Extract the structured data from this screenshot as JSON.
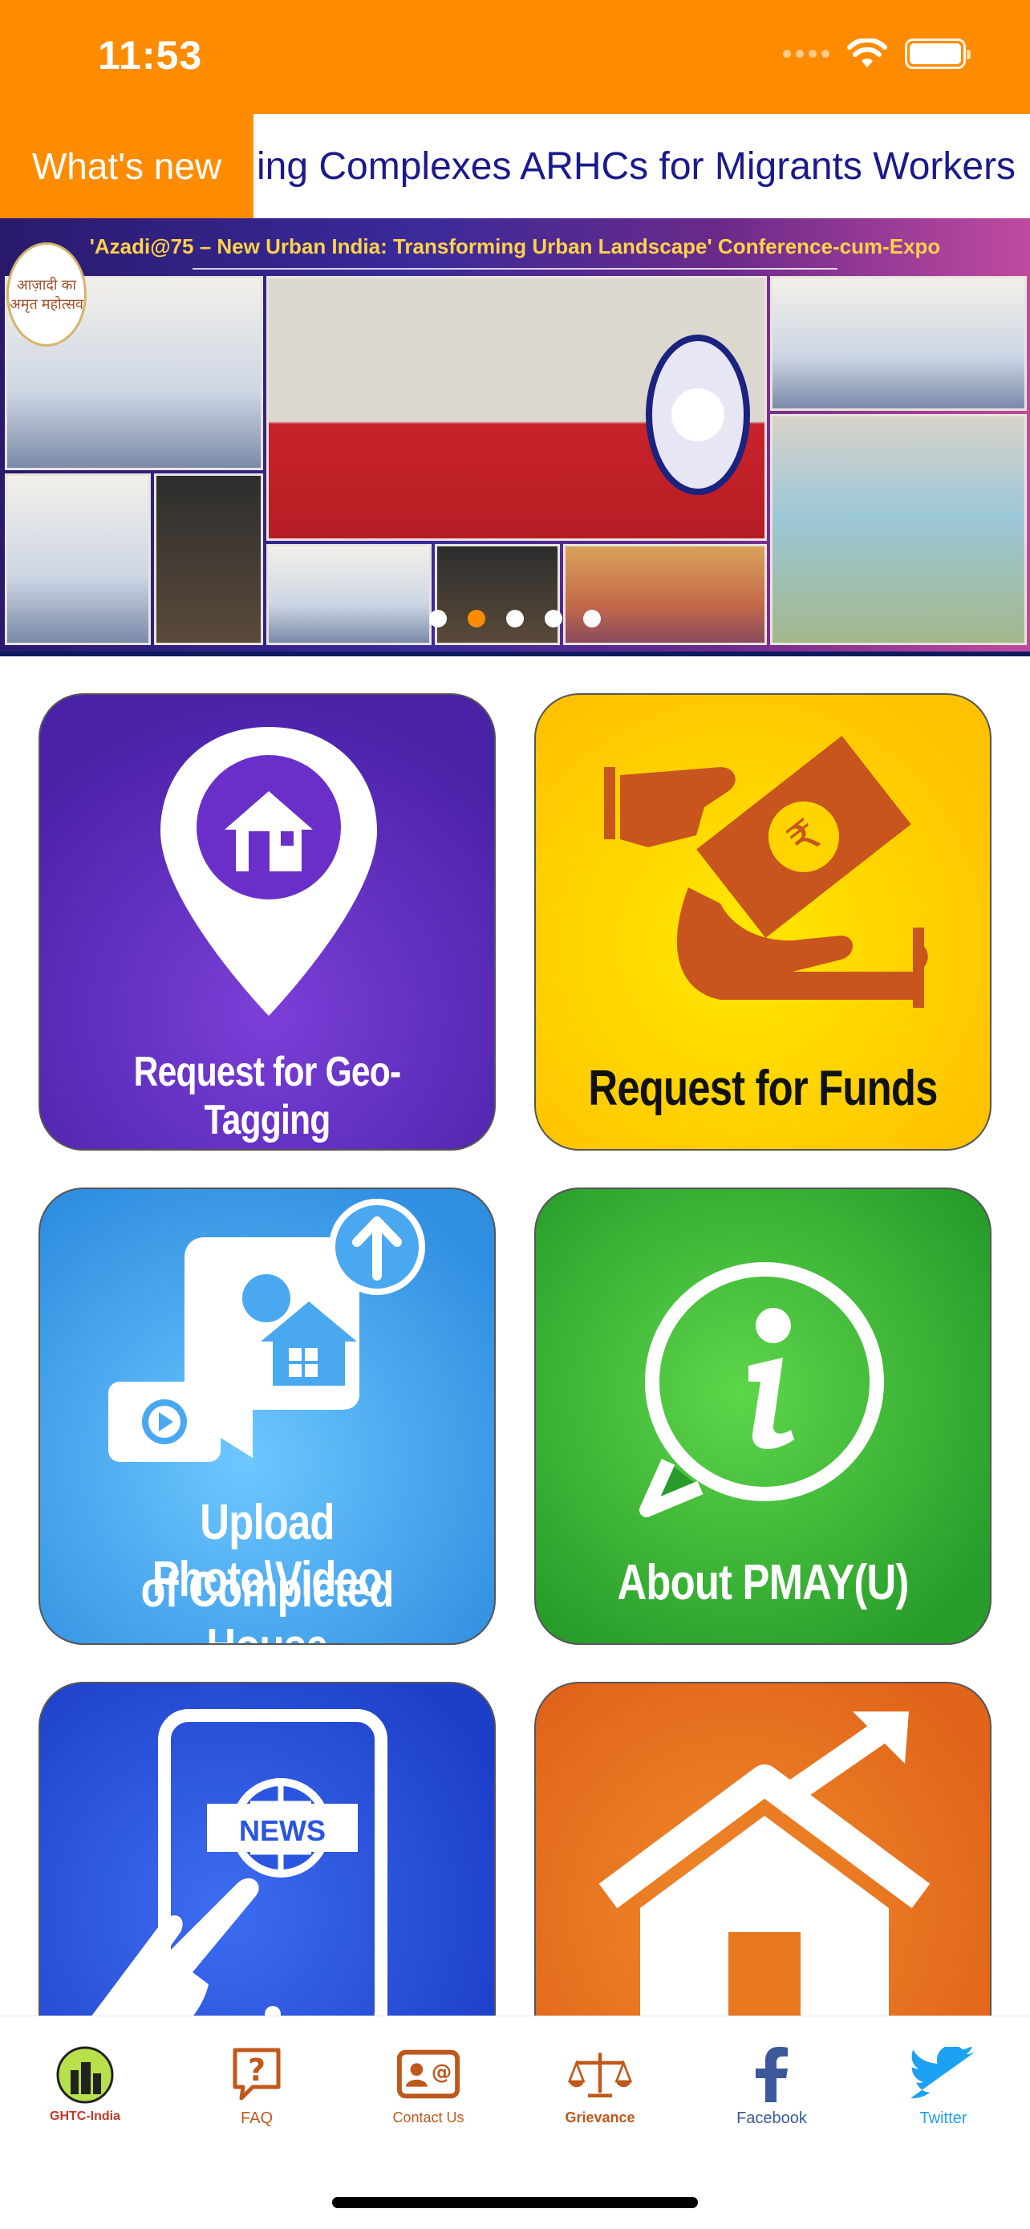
{
  "status_bar": {
    "time": "11:53"
  },
  "ticker": {
    "label": "What's new",
    "text": "ing Complexes ARHCs for Migrants Workers"
  },
  "banner": {
    "title": "'Azadi@75 – New Urban India: Transforming Urban Landscape' Conference-cum-Expo",
    "emblem_text": "आज़ादी का अमृत महोत्सव",
    "slide_count": 5,
    "active_slide": 2
  },
  "tiles": [
    {
      "label": "Request for Geo-Tagging",
      "icon": "location-pin-home-icon",
      "color": "#5a2bc0"
    },
    {
      "label": "Request for Funds",
      "icon": "hand-receiving-money-icon",
      "color": "#ffd400"
    },
    {
      "label_line1": "Upload Photo\\Video",
      "label_line2": "of Completed House",
      "icon": "upload-photo-video-icon",
      "color": "#4aa8f0"
    },
    {
      "label": "About PMAY(U)",
      "icon": "info-chat-icon",
      "color": "#3bb83a"
    },
    {
      "label": "",
      "icon": "tablet-news-icon",
      "color": "#2a55e0"
    },
    {
      "label": "",
      "icon": "house-growth-arrow-icon",
      "color": "#e8781f"
    }
  ],
  "tabbar": {
    "items": [
      {
        "label": "GHTC-India",
        "icon": "ghtc-india-icon",
        "color": "#c0392b"
      },
      {
        "label": "FAQ",
        "icon": "faq-icon",
        "color": "#c0581b"
      },
      {
        "label": "Contact Us",
        "icon": "contact-us-icon",
        "color": "#c0581b"
      },
      {
        "label": "Grievance",
        "icon": "grievance-scales-icon",
        "color": "#c0581b"
      },
      {
        "label": "Facebook",
        "icon": "facebook-icon",
        "color": "#3b5998"
      },
      {
        "label": "Twitter",
        "icon": "twitter-icon",
        "color": "#1da1f2"
      }
    ]
  }
}
